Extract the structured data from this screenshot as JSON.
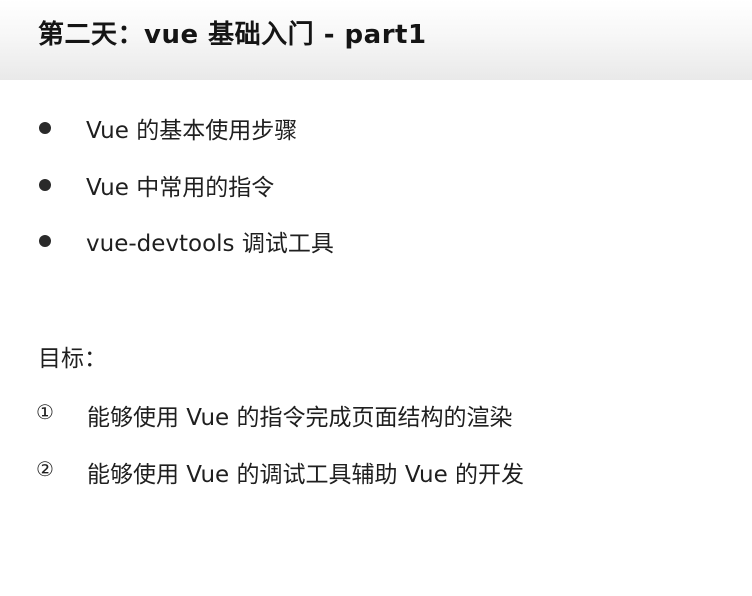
{
  "title": "第二天：vue 基础入门 - part1",
  "topics": [
    "Vue 的基本使用步骤",
    "Vue 中常用的指令",
    "vue-devtools 调试工具"
  ],
  "goals_heading": "目标：",
  "goals": [
    {
      "marker": "①",
      "text": "能够使用 Vue 的指令完成页面结构的渲染"
    },
    {
      "marker": "②",
      "text": "能够使用 Vue 的调试工具辅助 Vue 的开发"
    }
  ]
}
